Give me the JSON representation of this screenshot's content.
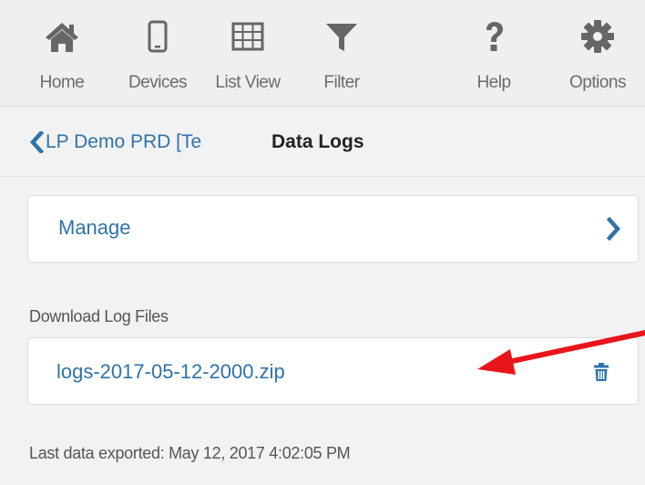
{
  "toolbar": {
    "items": [
      {
        "label": "Home",
        "icon": "home-icon"
      },
      {
        "label": "Devices",
        "icon": "phone-icon"
      },
      {
        "label": "List View",
        "icon": "table-icon"
      },
      {
        "label": "Filter",
        "icon": "filter-icon"
      },
      {
        "label": "Help",
        "icon": "question-icon"
      },
      {
        "label": "Options",
        "icon": "gear-icon"
      }
    ]
  },
  "breadcrumb": {
    "back_label": "LP Demo PRD [Te",
    "back_icon": "chevron-left-icon",
    "title": "Data Logs"
  },
  "manage": {
    "label": "Manage",
    "icon": "chevron-right-icon"
  },
  "downloads": {
    "heading": "Download Log Files",
    "files": [
      {
        "name": "logs-2017-05-12-2000.zip",
        "icon": "trash-icon"
      }
    ]
  },
  "footer": {
    "last_export": "Last data exported: May 12, 2017 4:02:05 PM"
  },
  "colors": {
    "link": "#2f73a8",
    "icon": "#666666",
    "annotation": "#e8161a"
  }
}
